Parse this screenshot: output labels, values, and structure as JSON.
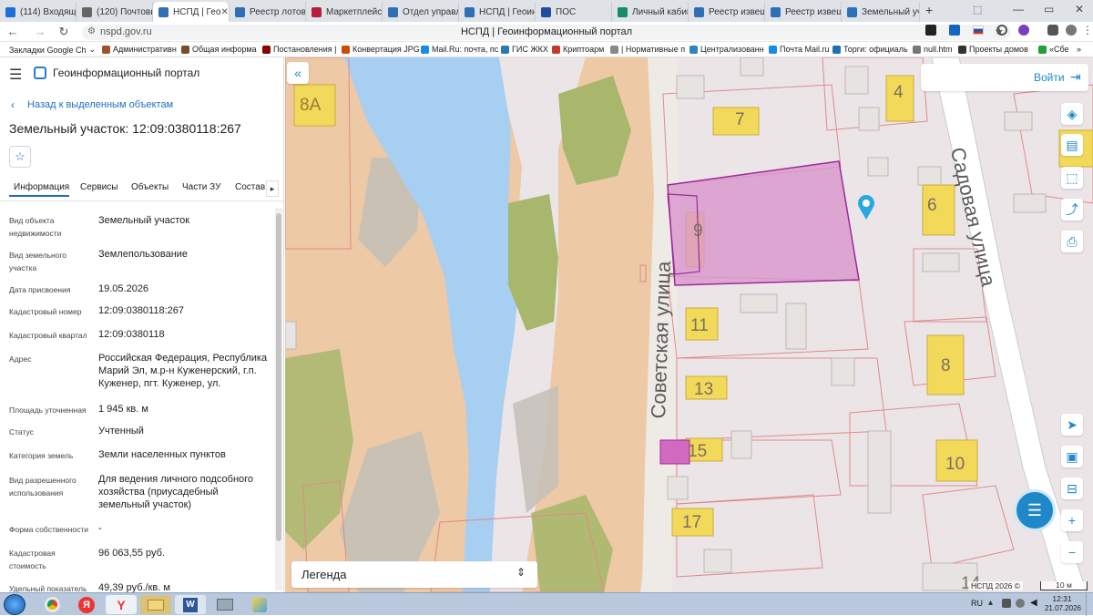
{
  "browser": {
    "tabs": [
      {
        "label": "(114) Входящи",
        "color": "#1e6fd9"
      },
      {
        "label": "(120) Почтовы",
        "color": "#666666"
      },
      {
        "label": "НСПД | Гео",
        "color": "#2f6fb5",
        "active": true
      },
      {
        "label": "Реестр лотов",
        "color": "#2f6fb5"
      },
      {
        "label": "Маркетплейс",
        "color": "#b51e3a"
      },
      {
        "label": "Отдел управле",
        "color": "#2f6fb5"
      },
      {
        "label": "НСПД | Геоинф",
        "color": "#2f6fb5"
      },
      {
        "label": "ПОС",
        "color": "#1e4f9e"
      },
      {
        "label": "Личный кабин",
        "color": "#168a6a"
      },
      {
        "label": "Реестр извещ",
        "color": "#2f6fb5"
      },
      {
        "label": "Реестр извещ",
        "color": "#2f6fb5"
      },
      {
        "label": "Земельный уч",
        "color": "#2f6fb5"
      }
    ],
    "new_tab": "+",
    "url_host": "nspd.gov.ru",
    "page_title": "НСПД | Геоинформационный портал",
    "bookmarks": [
      {
        "label": "Закладки Google Ch",
        "color": "#888888"
      },
      {
        "label": "Административн",
        "color": "#a0522d"
      },
      {
        "label": "Общая информа",
        "color": "#7a4b2a"
      },
      {
        "label": "Постановления |",
        "color": "#8b0000"
      },
      {
        "label": "Конвертация JPG",
        "color": "#d04a02"
      },
      {
        "label": "Mail.Ru: почта, пс",
        "color": "#168de2"
      },
      {
        "label": "ГИС ЖКХ",
        "color": "#2a7ab0"
      },
      {
        "label": "Криптоарм",
        "color": "#c0392b"
      },
      {
        "label": "| Нормативные п",
        "color": "#888888"
      },
      {
        "label": "Централизованн",
        "color": "#2e86c1"
      },
      {
        "label": "Почта Mail.ru",
        "color": "#168de2"
      },
      {
        "label": "Торги: официаль",
        "color": "#1f6fb2"
      },
      {
        "label": "null.htm",
        "color": "#777777"
      },
      {
        "label": "Проекты домов",
        "color": "#333333"
      },
      {
        "label": "«Сбе",
        "color": "#21a038"
      }
    ]
  },
  "portal": {
    "title": "Геоинформационный портал",
    "back_link": "Назад к выделенным объектам",
    "object_title": "Земельный участок: 12:09:0380118:267",
    "tabs": [
      "Информация",
      "Сервисы",
      "Объекты",
      "Части ЗУ",
      "Состав"
    ],
    "active_tab": "Информация",
    "fields": [
      {
        "label": "Вид объекта недвижимости",
        "value": "Земельный участок"
      },
      {
        "label": "Вид земельного участка",
        "value": "Землепользование"
      },
      {
        "label": "Дата присвоения",
        "value": "19.05.2026"
      },
      {
        "label": "Кадастровый номер",
        "value": "12:09:0380118:267"
      },
      {
        "label": "Кадастровый квартал",
        "value": "12:09:0380118"
      },
      {
        "label": "Адрес",
        "value": "Российская Федерация, Республика Марий Эл, м.р-н Куженерский, г.п. Куженер, пгт. Куженер, ул."
      },
      {
        "label": "Площадь уточненная",
        "value": "1 945 кв. м"
      },
      {
        "label": "Статус",
        "value": "Учтенный"
      },
      {
        "label": "Категория земель",
        "value": "Земли населенных пунктов"
      },
      {
        "label": "Вид разрешенного использования",
        "value": "Для ведения личного подсобного хозяйства (приусадебный земельный участок)"
      },
      {
        "label": "Форма собственности",
        "value": "-"
      },
      {
        "label": "Кадастровая стоимость",
        "value": "96 063,55 руб."
      },
      {
        "label": "Удельный показатель",
        "value": "49,39 руб./кв. м"
      }
    ]
  },
  "map": {
    "login": "Войти",
    "legend": "Легенда",
    "copyright": "НСПД 2026 ©",
    "scale": "10 м",
    "streets": [
      "Советская улица",
      "Садовая улица"
    ],
    "house_numbers": [
      "8А",
      "7",
      "4",
      "9",
      "6",
      "11",
      "8",
      "13",
      "15",
      "10",
      "17",
      "14"
    ]
  },
  "taskbar": {
    "lang": "RU",
    "time": "12:31",
    "date": "21.07.2026"
  }
}
